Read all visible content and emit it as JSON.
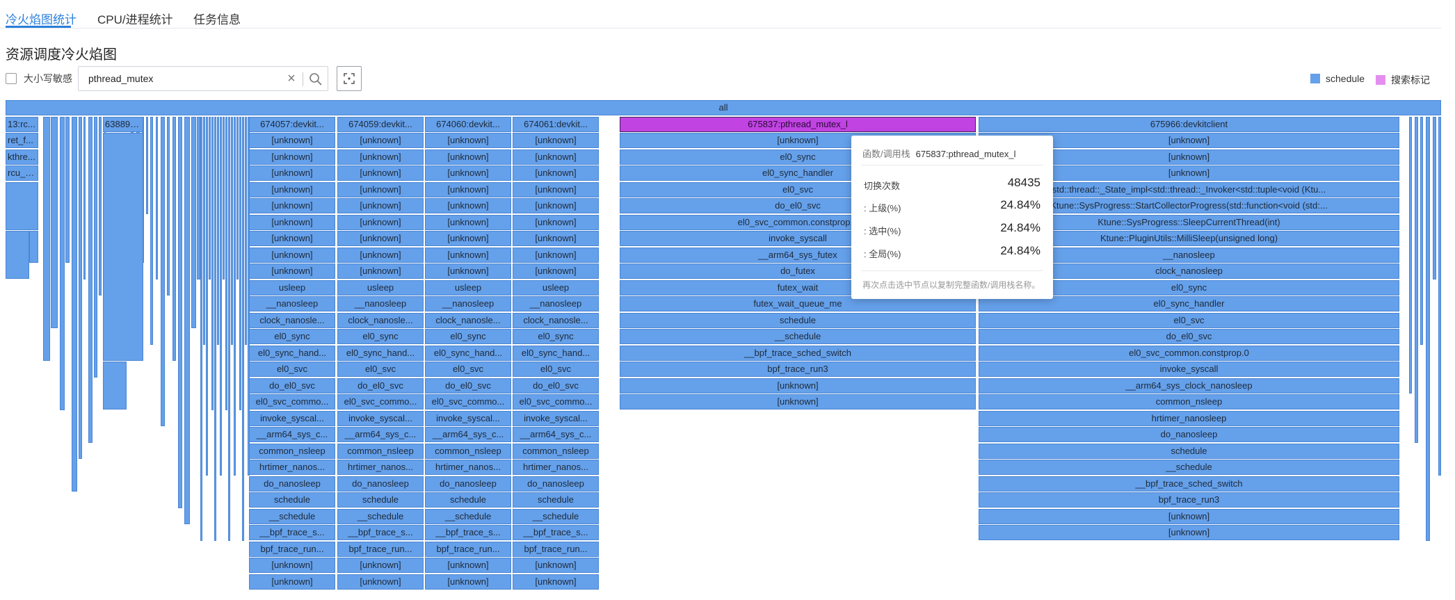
{
  "tabs": [
    {
      "label": "冷火焰图统计",
      "active": true
    },
    {
      "label": "CPU/进程统计",
      "active": false
    },
    {
      "label": "任务信息",
      "active": false
    }
  ],
  "page_title": "资源调度冷火焰图",
  "toolbar": {
    "case_sensitive_label": "大小写敏感",
    "search_value": "pthread_mutex",
    "search_placeholder": ""
  },
  "legend": [
    {
      "label": "schedule",
      "color": "#65a0ea"
    },
    {
      "label": "搜索标记",
      "color": "#e48ff0"
    }
  ],
  "colors": {
    "frame": "#65a0ea",
    "highlight": "#c043e2",
    "accent": "#2b7fd9"
  },
  "flame": {
    "root": "all",
    "left_columns": [
      "13:rc...",
      "ret_f...",
      "kthre...",
      "rcu_g..."
    ],
    "small_stack_top": "638892...",
    "devkit_stack": [
      "[unknown]",
      "[unknown]",
      "[unknown]",
      "[unknown]",
      "[unknown]",
      "[unknown]",
      "[unknown]",
      "[unknown]",
      "[unknown]",
      "usleep",
      "__nanosleep",
      "clock_nanosle...",
      "el0_sync",
      "el0_sync_hand...",
      "el0_svc",
      "do_el0_svc",
      "el0_svc_commo...",
      "invoke_syscal...",
      "__arm64_sys_c...",
      "common_nsleep",
      "hrtimer_nanos...",
      "do_nanosleep",
      "schedule",
      "__schedule",
      "__bpf_trace_s...",
      "bpf_trace_run...",
      "[unknown]",
      "[unknown]"
    ],
    "devkit_roots": [
      "674057:devkit...",
      "674059:devkit...",
      "674060:devkit...",
      "674061:devkit..."
    ],
    "highlight_root": "675837:pthread_mutex_l",
    "highlight_stack": [
      "[unknown]",
      "el0_sync",
      "el0_sync_handler",
      "el0_svc",
      "do_el0_svc",
      "el0_svc_common.constprop.0",
      "invoke_syscall",
      "__arm64_sys_futex",
      "do_futex",
      "futex_wait",
      "futex_wait_queue_me",
      "schedule",
      "__schedule",
      "__bpf_trace_sched_switch",
      "bpf_trace_run3",
      "[unknown]",
      "[unknown]"
    ],
    "client_root": "675966:devkitclient",
    "client_stack": [
      "[unknown]",
      "[unknown]",
      "[unknown]",
      "std::thread::_State_impl<std::thread::_Invoker<std::tuple<void (Ktu...",
      "Ktune::SysProgress::StartCollectorProgress(std::function<void (std:...",
      "Ktune::SysProgress::SleepCurrentThread(int)",
      "Ktune::PluginUtils::MilliSleep(unsigned long)",
      "__nanosleep",
      "clock_nanosleep",
      "el0_sync",
      "el0_sync_handler",
      "el0_svc",
      "do_el0_svc",
      "el0_svc_common.constprop.0",
      "invoke_syscall",
      "__arm64_sys_clock_nanosleep",
      "common_nsleep",
      "hrtimer_nanosleep",
      "do_nanosleep",
      "schedule",
      "__schedule",
      "__bpf_trace_sched_switch",
      "bpf_trace_run3",
      "[unknown]",
      "[unknown]"
    ]
  },
  "tooltip": {
    "header_label": "函数/调用栈",
    "header_value": "675837:pthread_mutex_l",
    "rows": [
      {
        "label": "切换次数",
        "value": "48435"
      },
      {
        "label": ": 上级(%)",
        "value": "24.84%"
      },
      {
        "label": ": 选中(%)",
        "value": "24.84%"
      },
      {
        "label": ": 全局(%)",
        "value": "24.84%"
      }
    ],
    "footer": "再次点击选中节点以复制完整函数/调用栈名称。"
  }
}
